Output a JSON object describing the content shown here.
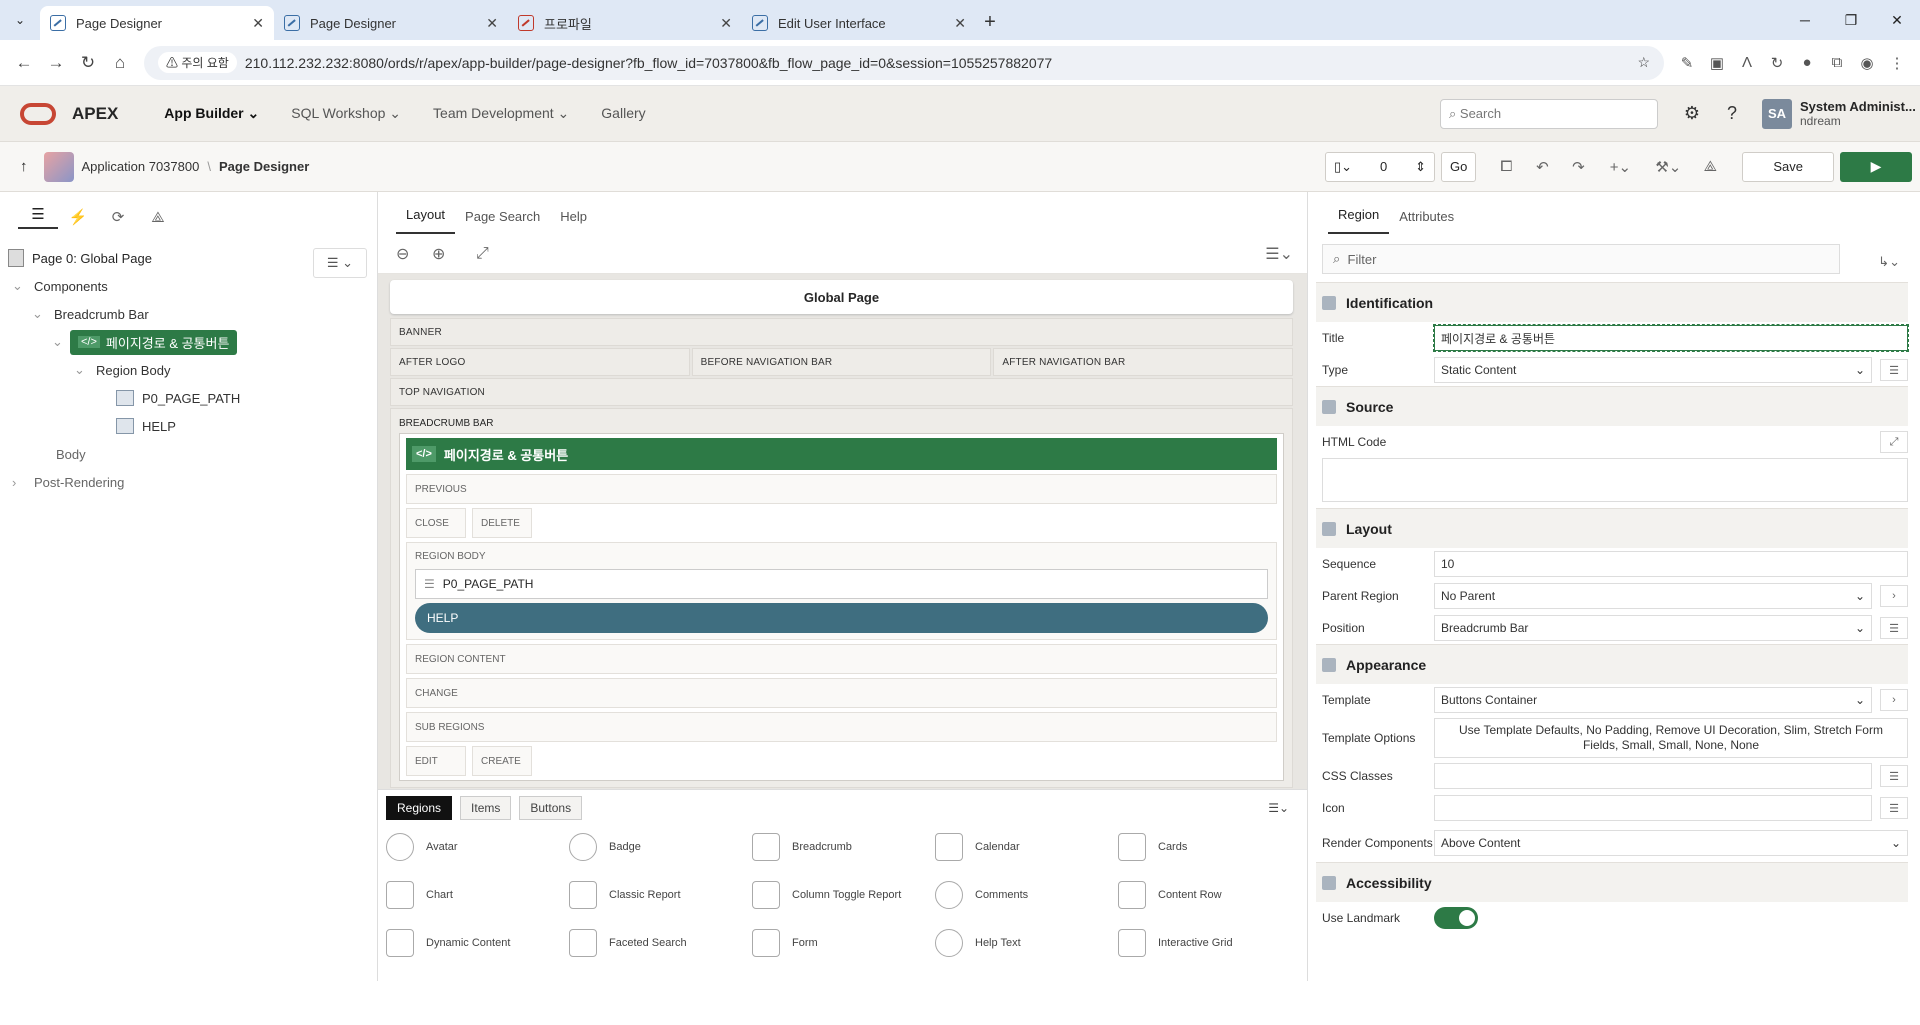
{
  "browser": {
    "tabs": [
      {
        "title": "Page Designer",
        "active": true
      },
      {
        "title": "Page Designer",
        "active": false
      },
      {
        "title": "프로파일",
        "active": false
      },
      {
        "title": "Edit User Interface",
        "active": false
      }
    ],
    "warning": "주의 요함",
    "url": "210.112.232.232:8080/ords/r/apex/app-builder/page-designer?fb_flow_id=7037800&fb_flow_page_id=0&session=1055257882077"
  },
  "apex": {
    "logo": "APEX",
    "nav": [
      "App Builder",
      "SQL Workshop",
      "Team Development",
      "Gallery"
    ],
    "search_placeholder": "Search",
    "user_initials": "SA",
    "user_name": "System Administ...",
    "workspace": "ndream"
  },
  "toolbar": {
    "app": "Application 7037800",
    "page": "Page Designer",
    "page_number": "0",
    "go": "Go",
    "save": "Save"
  },
  "left": {
    "root": "Page 0: Global Page",
    "components": "Components",
    "breadcrumb_bar": "Breadcrumb Bar",
    "region": "페이지경로 & 공통버튼",
    "region_body": "Region Body",
    "item1": "P0_PAGE_PATH",
    "item2": "HELP",
    "body": "Body",
    "post": "Post-Rendering"
  },
  "mid": {
    "tabs": [
      "Layout",
      "Page Search",
      "Help"
    ],
    "page_title": "Global Page",
    "banner": "BANNER",
    "after_logo": "AFTER LOGO",
    "before_nav": "BEFORE NAVIGATION BAR",
    "after_nav": "AFTER NAVIGATION BAR",
    "top_nav": "TOP NAVIGATION",
    "bc_bar": "BREADCRUMB BAR",
    "region": "페이지경로 & 공통버튼",
    "previous": "PREVIOUS",
    "close": "CLOSE",
    "delete": "DELETE",
    "region_body": "REGION BODY",
    "item1": "P0_PAGE_PATH",
    "item2": "HELP",
    "region_content": "REGION CONTENT",
    "change": "CHANGE",
    "sub_regions": "SUB REGIONS",
    "edit": "EDIT",
    "create": "CREATE"
  },
  "gallery": {
    "tabs": [
      "Regions",
      "Items",
      "Buttons"
    ],
    "items": [
      "Avatar",
      "Badge",
      "Breadcrumb",
      "Calendar",
      "Cards",
      "Chart",
      "Classic Report",
      "Column Toggle Report",
      "Comments",
      "Content Row",
      "Dynamic Content",
      "Faceted Search",
      "Form",
      "Help Text",
      "Interactive Grid"
    ]
  },
  "right": {
    "tabs": [
      "Region",
      "Attributes"
    ],
    "filter": "Filter",
    "identification": "Identification",
    "title_label": "Title",
    "title_value": "페이지경로 & 공통버튼",
    "type_label": "Type",
    "type_value": "Static Content",
    "source": "Source",
    "html_code": "HTML Code",
    "layout": "Layout",
    "sequence_label": "Sequence",
    "sequence_value": "10",
    "parent_label": "Parent Region",
    "parent_value": "No Parent",
    "position_label": "Position",
    "position_value": "Breadcrumb Bar",
    "appearance": "Appearance",
    "template_label": "Template",
    "template_value": "Buttons Container",
    "tplopts_label": "Template Options",
    "tplopts_value": "Use Template Defaults, No Padding, Remove UI Decoration, Slim, Stretch Form Fields, Small, Small, None, None",
    "css_label": "CSS Classes",
    "icon_label": "Icon",
    "render_label": "Render Components",
    "render_value": "Above Content",
    "accessibility": "Accessibility",
    "landmark_label": "Use Landmark"
  }
}
